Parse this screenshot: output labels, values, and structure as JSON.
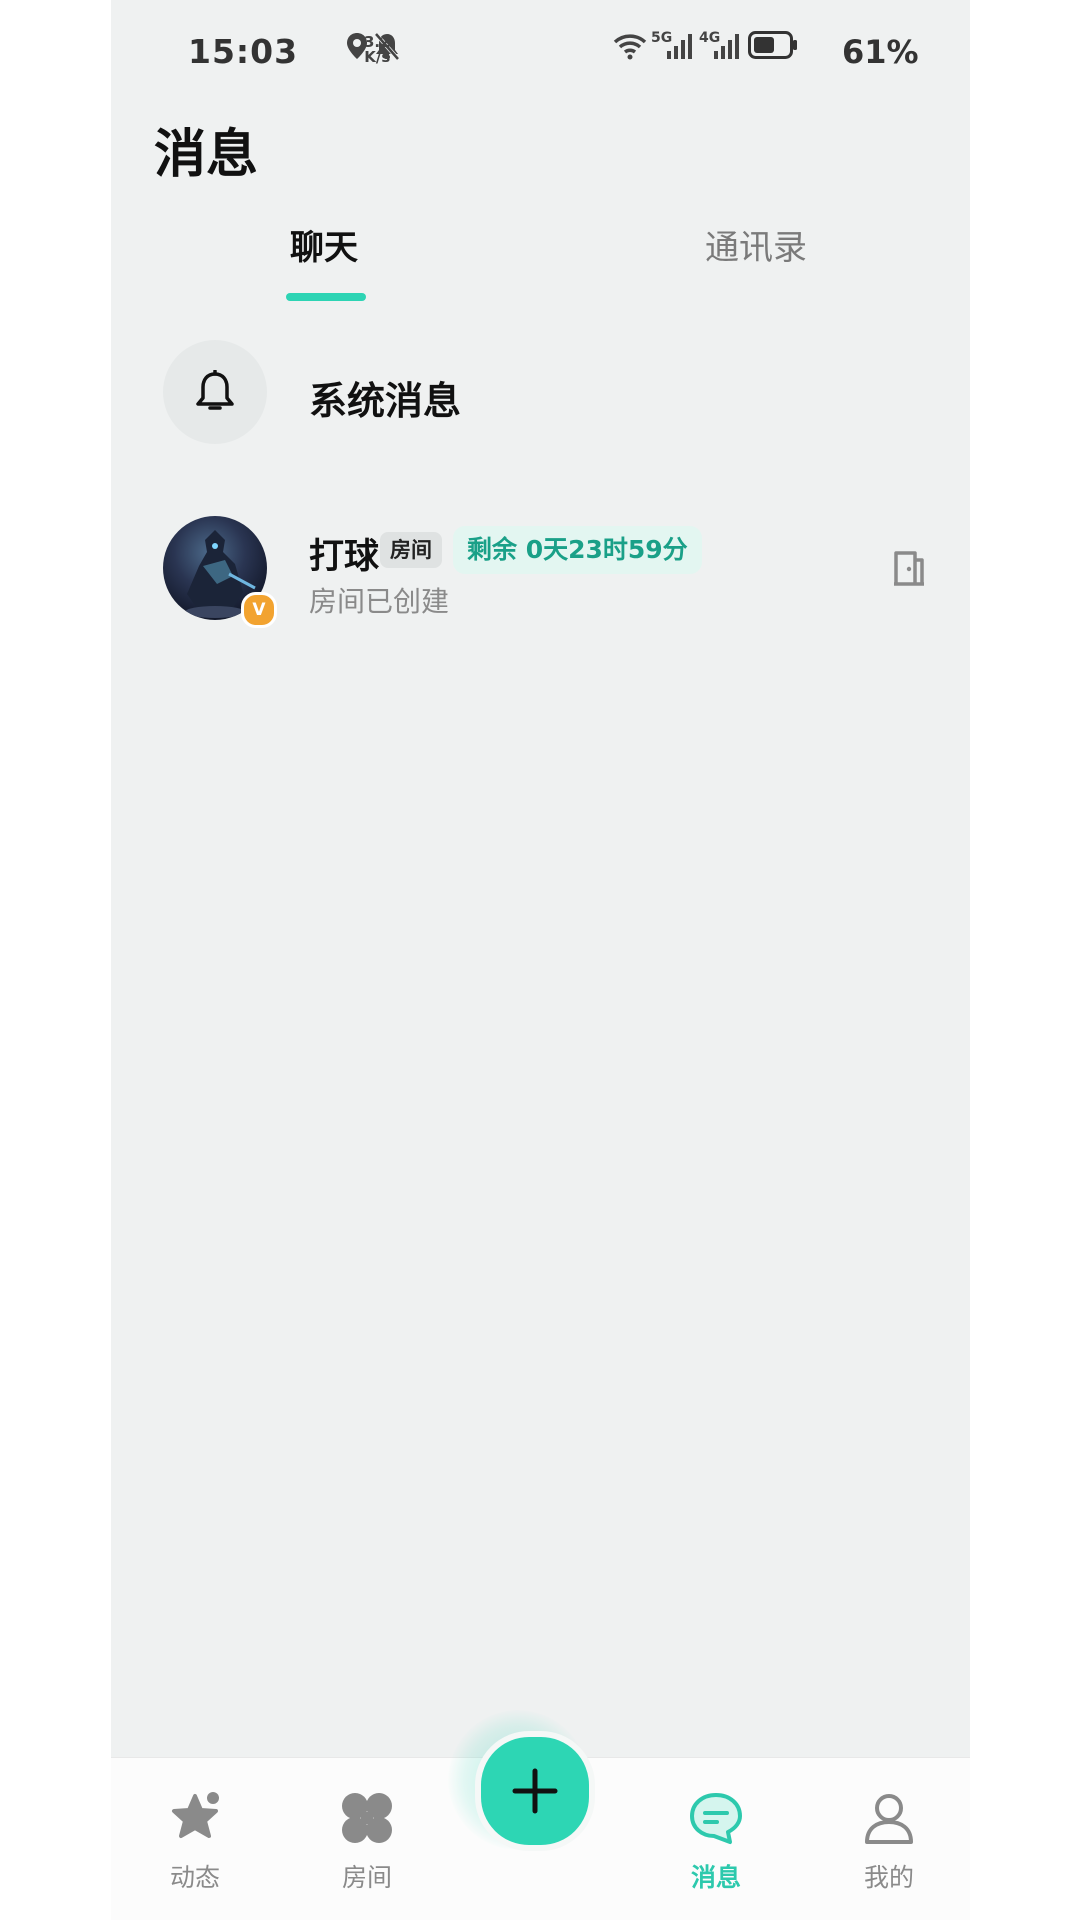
{
  "status_bar": {
    "time": "15:03",
    "net_speed_value": "3.2",
    "net_speed_unit": "K/s",
    "signal_5g": "5G",
    "signal_4g": "4G",
    "battery_percent": "61%",
    "battery_level": 0.61
  },
  "header": {
    "title": "消息",
    "tabs": [
      {
        "label": "聊天",
        "active": true
      },
      {
        "label": "通讯录",
        "active": false
      }
    ]
  },
  "system_messages": {
    "label": "系统消息",
    "icon": "bell-icon"
  },
  "chats": [
    {
      "name": "打球",
      "tag": "房间",
      "remaining": "剩余 0天23时59分",
      "subtitle": "房间已创建",
      "badge": "V",
      "action_icon": "door-icon"
    }
  ],
  "bottom_nav": {
    "items": [
      {
        "label": "动态",
        "icon": "star-icon",
        "active": false
      },
      {
        "label": "房间",
        "icon": "clover-icon",
        "active": false
      },
      {
        "label": "消息",
        "icon": "chat-bubble-icon",
        "active": true
      },
      {
        "label": "我的",
        "icon": "person-icon",
        "active": false
      }
    ],
    "fab_icon": "plus-icon"
  },
  "colors": {
    "accent": "#2dd4b4",
    "background": "#eff1f1",
    "remaining_text": "#1aa088",
    "vip_badge": "#f2a330"
  }
}
